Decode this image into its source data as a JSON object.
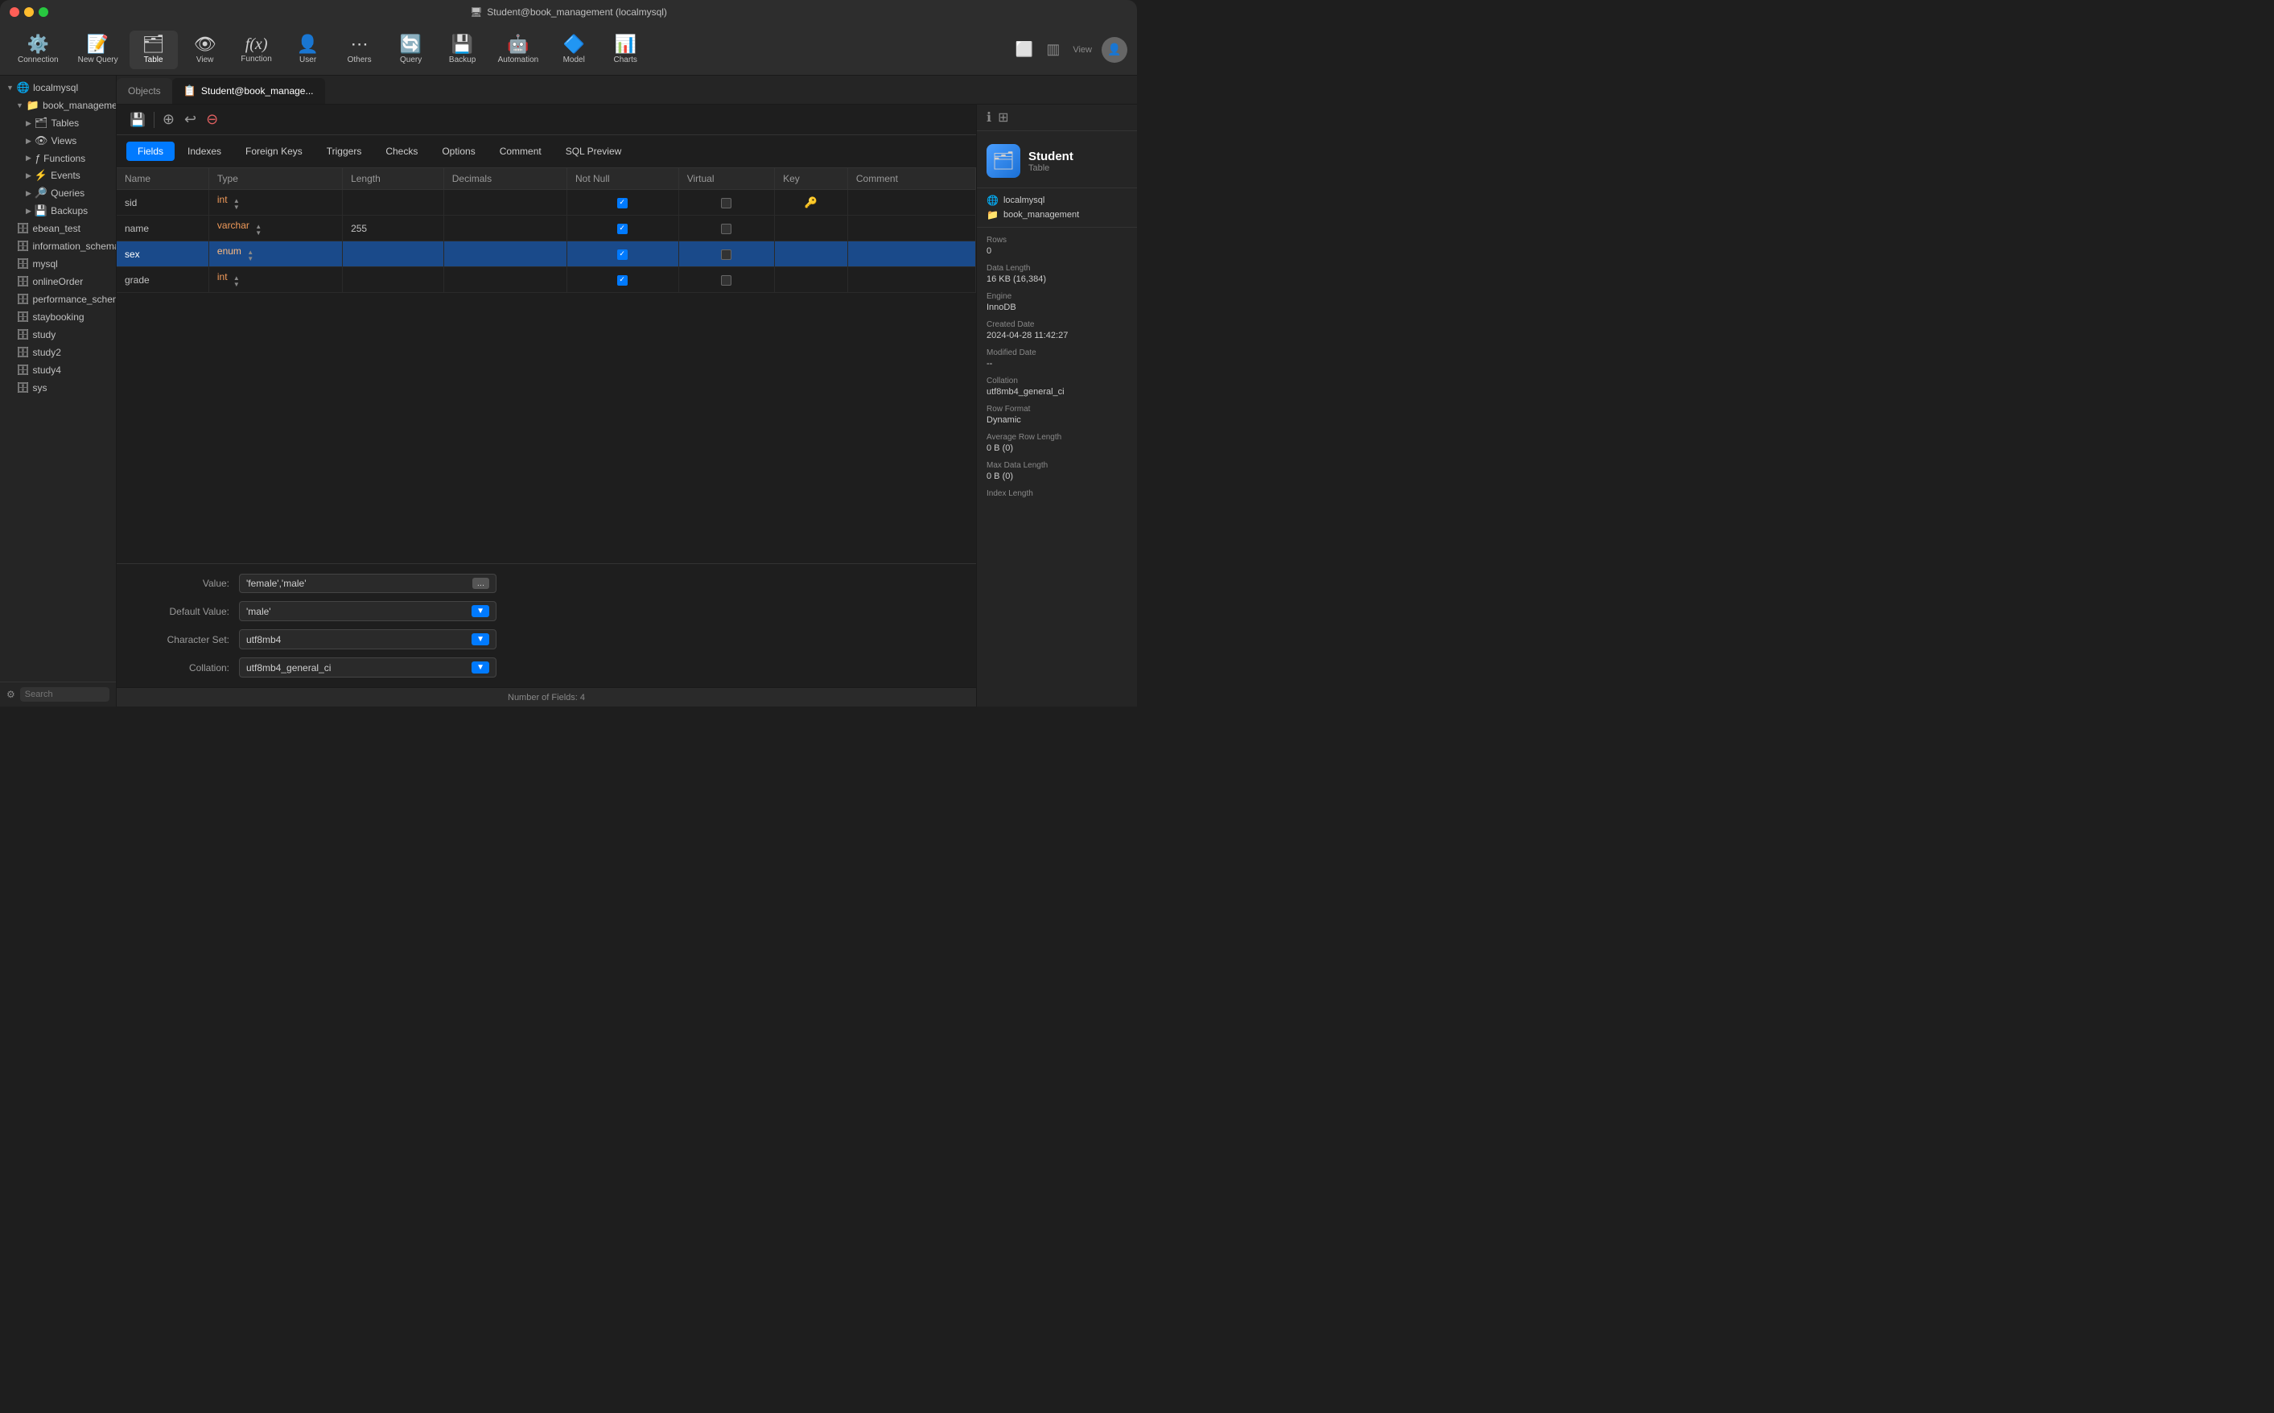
{
  "titlebar": {
    "title": "🖥 Student@book_management (localmysql)"
  },
  "toolbar": {
    "items": [
      {
        "id": "connection",
        "label": "Connection",
        "icon": "⚙️"
      },
      {
        "id": "new-query",
        "label": "New Query",
        "icon": "📝"
      },
      {
        "id": "table",
        "label": "Table",
        "icon": "🗂"
      },
      {
        "id": "view",
        "label": "View",
        "icon": "👁"
      },
      {
        "id": "function",
        "label": "Function",
        "icon": "ƒ"
      },
      {
        "id": "user",
        "label": "User",
        "icon": "👤"
      },
      {
        "id": "others",
        "label": "Others",
        "icon": "⋯"
      },
      {
        "id": "query",
        "label": "Query",
        "icon": "🔄"
      },
      {
        "id": "backup",
        "label": "Backup",
        "icon": "💾"
      },
      {
        "id": "automation",
        "label": "Automation",
        "icon": "🤖"
      },
      {
        "id": "model",
        "label": "Model",
        "icon": "🔷"
      },
      {
        "id": "charts",
        "label": "Charts",
        "icon": "📊"
      }
    ],
    "view_label": "View"
  },
  "sidebar": {
    "tree": [
      {
        "id": "localmysql",
        "label": "localmysql",
        "level": 0,
        "arrow": "▼",
        "icon": "🌐",
        "expanded": true
      },
      {
        "id": "book_management",
        "label": "book_management",
        "level": 1,
        "arrow": "▼",
        "icon": "📁",
        "expanded": true
      },
      {
        "id": "tables",
        "label": "Tables",
        "level": 2,
        "arrow": "▶",
        "icon": "🗂"
      },
      {
        "id": "views",
        "label": "Views",
        "level": 2,
        "arrow": "▶",
        "icon": "👁"
      },
      {
        "id": "functions",
        "label": "Functions",
        "level": 2,
        "arrow": "▶",
        "icon": "ƒ"
      },
      {
        "id": "events",
        "label": "Events",
        "level": 2,
        "arrow": "▶",
        "icon": "⚡"
      },
      {
        "id": "queries",
        "label": "Queries",
        "level": 2,
        "arrow": "▶",
        "icon": "🔎"
      },
      {
        "id": "backups",
        "label": "Backups",
        "level": 2,
        "arrow": "▶",
        "icon": "💾"
      },
      {
        "id": "ebean_test",
        "label": "ebean_test",
        "level": 1,
        "arrow": "",
        "icon": "🗄"
      },
      {
        "id": "information_schema",
        "label": "information_schema",
        "level": 1,
        "arrow": "",
        "icon": "🗄"
      },
      {
        "id": "mysql",
        "label": "mysql",
        "level": 1,
        "arrow": "",
        "icon": "🗄"
      },
      {
        "id": "onlineOrder",
        "label": "onlineOrder",
        "level": 1,
        "arrow": "",
        "icon": "🗄"
      },
      {
        "id": "performance_schema",
        "label": "performance_schema",
        "level": 1,
        "arrow": "",
        "icon": "🗄"
      },
      {
        "id": "staybooking",
        "label": "staybooking",
        "level": 1,
        "arrow": "",
        "icon": "🗄"
      },
      {
        "id": "study",
        "label": "study",
        "level": 1,
        "arrow": "",
        "icon": "🗄"
      },
      {
        "id": "study2",
        "label": "study2",
        "level": 1,
        "arrow": "",
        "icon": "🗄"
      },
      {
        "id": "study4",
        "label": "study4",
        "level": 1,
        "arrow": "",
        "icon": "🗄"
      },
      {
        "id": "sys",
        "label": "sys",
        "level": 1,
        "arrow": "",
        "icon": "🗄"
      }
    ],
    "search_placeholder": "Search"
  },
  "tabs": [
    {
      "id": "objects",
      "label": "Objects",
      "icon": "",
      "active": false
    },
    {
      "id": "student",
      "label": "Student@book_manage...",
      "icon": "📋",
      "active": true
    }
  ],
  "field_tabs": [
    {
      "id": "fields",
      "label": "Fields",
      "active": true
    },
    {
      "id": "indexes",
      "label": "Indexes",
      "active": false
    },
    {
      "id": "foreign_keys",
      "label": "Foreign Keys",
      "active": false
    },
    {
      "id": "triggers",
      "label": "Triggers",
      "active": false
    },
    {
      "id": "checks",
      "label": "Checks",
      "active": false
    },
    {
      "id": "options",
      "label": "Options",
      "active": false
    },
    {
      "id": "comment",
      "label": "Comment",
      "active": false
    },
    {
      "id": "sql_preview",
      "label": "SQL Preview",
      "active": false
    }
  ],
  "table_columns": [
    "Name",
    "Type",
    "Length",
    "Decimals",
    "Not Null",
    "Virtual",
    "Key",
    "Comment"
  ],
  "table_rows": [
    {
      "name": "sid",
      "type": "int",
      "length": "",
      "decimals": "",
      "not_null": true,
      "virtual": false,
      "key": true,
      "comment": ""
    },
    {
      "name": "name",
      "type": "varchar",
      "length": "255",
      "decimals": "",
      "not_null": true,
      "virtual": false,
      "key": false,
      "comment": ""
    },
    {
      "name": "sex",
      "type": "enum",
      "length": "",
      "decimals": "",
      "not_null": true,
      "virtual": false,
      "key": false,
      "comment": "",
      "selected": true
    },
    {
      "name": "grade",
      "type": "int",
      "length": "",
      "decimals": "",
      "not_null": true,
      "virtual": false,
      "key": false,
      "comment": ""
    }
  ],
  "bottom_panel": {
    "value_label": "Value:",
    "value": "'female','male'",
    "default_value_label": "Default Value:",
    "default_value": "'male'",
    "charset_label": "Character Set:",
    "charset": "utf8mb4",
    "collation_label": "Collation:",
    "collation": "utf8mb4_general_ci"
  },
  "statusbar": {
    "text": "Number of Fields: 4"
  },
  "right_panel": {
    "title": "Student",
    "subtitle": "Table",
    "icon": "🗂",
    "breadcrumb": [
      {
        "label": "localmysql",
        "icon": "🌐"
      },
      {
        "label": "book_management",
        "icon": "📁"
      }
    ],
    "meta": [
      {
        "label": "Rows",
        "value": "0"
      },
      {
        "label": "Data Length",
        "value": "16 KB (16,384)"
      },
      {
        "label": "Engine",
        "value": "InnoDB"
      },
      {
        "label": "Created Date",
        "value": "2024-04-28 11:42:27"
      },
      {
        "label": "Modified Date",
        "value": "--"
      },
      {
        "label": "Collation",
        "value": "utf8mb4_general_ci"
      },
      {
        "label": "Row Format",
        "value": "Dynamic"
      },
      {
        "label": "Average Row Length",
        "value": "0 B (0)"
      },
      {
        "label": "Max Data Length",
        "value": "0 B (0)"
      },
      {
        "label": "Index Length",
        "value": ""
      }
    ]
  },
  "strip_buttons": [
    {
      "id": "save",
      "icon": "💾"
    },
    {
      "id": "add",
      "icon": "+"
    },
    {
      "id": "undo",
      "icon": "↩"
    },
    {
      "id": "delete",
      "icon": "🗑"
    }
  ]
}
